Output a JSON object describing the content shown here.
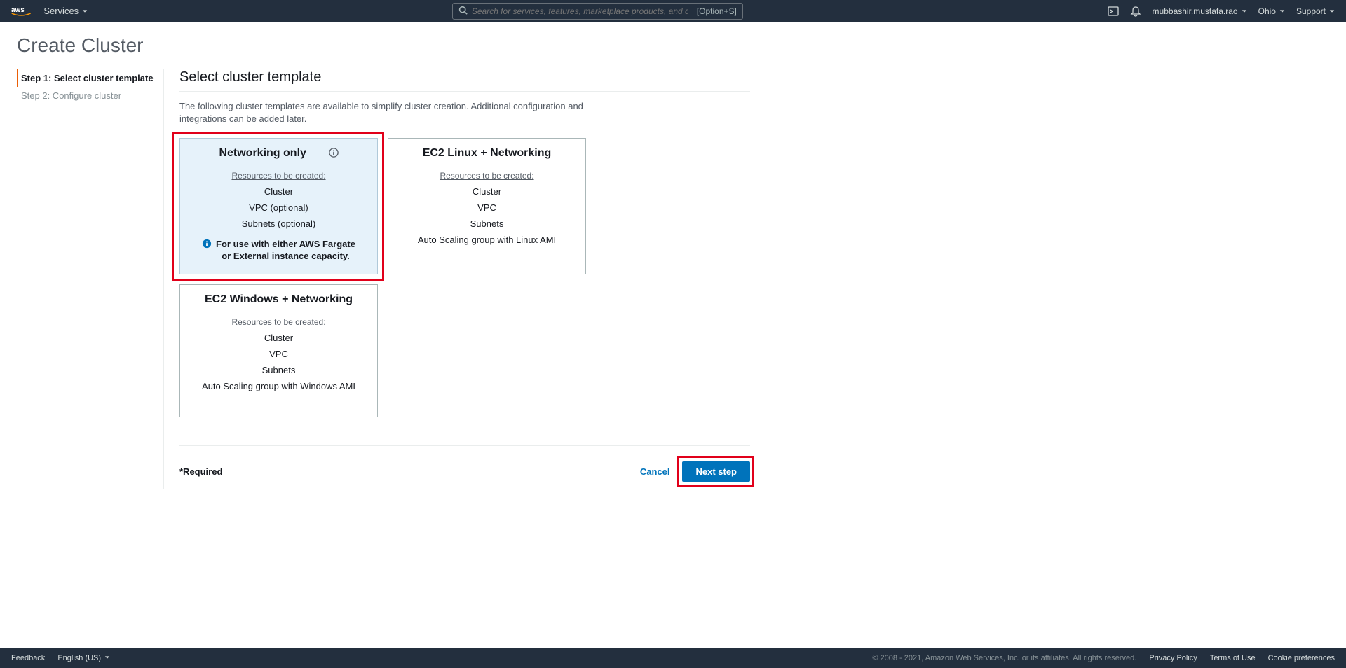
{
  "nav": {
    "services": "Services",
    "search_placeholder": "Search for services, features, marketplace products, and docs",
    "search_shortcut": "[Option+S]",
    "user": "mubbashir.mustafa.rao",
    "region": "Ohio",
    "support": "Support"
  },
  "page": {
    "title": "Create Cluster"
  },
  "steps": {
    "s1": "Step 1: Select cluster template",
    "s2": "Step 2: Configure cluster"
  },
  "section": {
    "title": "Select cluster template",
    "desc": "The following cluster templates are available to simplify cluster creation. Additional configuration and integrations can be added later."
  },
  "t1": {
    "title": "Networking only",
    "res_label": "Resources to be created:",
    "r1": "Cluster",
    "r2": "VPC (optional)",
    "r3": "Subnets (optional)",
    "note": "For use with either AWS Fargate or External instance capacity."
  },
  "t2": {
    "title": "EC2 Linux + Networking",
    "res_label": "Resources to be created:",
    "r1": "Cluster",
    "r2": "VPC",
    "r3": "Subnets",
    "r4": "Auto Scaling group with Linux AMI"
  },
  "t3": {
    "title": "EC2 Windows + Networking",
    "res_label": "Resources to be created:",
    "r1": "Cluster",
    "r2": "VPC",
    "r3": "Subnets",
    "r4": "Auto Scaling group with Windows AMI"
  },
  "footer": {
    "required": "*Required",
    "cancel": "Cancel",
    "next": "Next step"
  },
  "bottom": {
    "feedback": "Feedback",
    "language": "English (US)",
    "copyright": "© 2008 - 2021, Amazon Web Services, Inc. or its affiliates. All rights reserved.",
    "privacy": "Privacy Policy",
    "terms": "Terms of Use",
    "cookies": "Cookie preferences"
  }
}
